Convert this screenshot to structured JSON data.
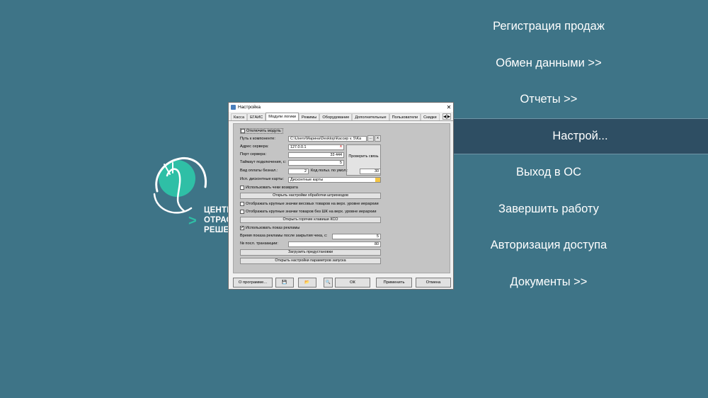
{
  "logo": {
    "line1": "ЦЕНТР",
    "line2": "ОТРАСЛЕ",
    "line3": "РЕШЕНИЙ",
    "arrow": ">",
    "accent": "#2fbfa6"
  },
  "menu": {
    "items": [
      {
        "label": "Регистрация продаж",
        "active": false
      },
      {
        "label": "Обмен данными >>",
        "active": false
      },
      {
        "label": "Отчеты >>",
        "active": false
      },
      {
        "label": "Настрой...",
        "active": true
      },
      {
        "label": "Выход в ОС",
        "active": false
      },
      {
        "label": "Завершить работу",
        "active": false
      },
      {
        "label": "Авторизация доступа",
        "active": false
      },
      {
        "label": "Документы >>",
        "active": false
      }
    ]
  },
  "dialog": {
    "title": "Настройка",
    "close": "✕",
    "tabs": [
      "Касса",
      "ЕГАИС",
      "Модули логики",
      "Режимы",
      "Оборудование",
      "Дополнительные",
      "Пользователи",
      "Скидки"
    ],
    "active_tab": "Модули логики",
    "tab_prev": "◀",
    "tab_next": "▶",
    "disable_module": "Отключить модуль",
    "component_path_label": "Путь к компоненте:",
    "component_path_value": "C:\\Users\\Марина\\Desktop\\Кассир v. 5\\Ka",
    "browse": "...",
    "clear": "x",
    "server_address_label": "Адрес сервера:",
    "server_address_value": "127.0.0.1",
    "server_port_label": "Порт сервера:",
    "server_port_value": "33 444",
    "check_connection": "Проверить связь",
    "timeout_label": "Таймаут подключения, с:",
    "timeout_value": "5",
    "cashless_label": "Вид оплаты безнал.:",
    "cashless_value": "2",
    "default_user_label": "Код польз. по умол.:",
    "default_user_value": "30",
    "discount_cards_label": "Исп. дисконтные карты:",
    "discount_cards_value": "Дисконтные карты",
    "use_return_checks": "Использовать чеки возврата",
    "open_barcode_settings": "Открыть настройки обработки штрихкодов",
    "show_large_weight_icons": "Отображать крупные значки весовых товаров на верх. уровне иерархии",
    "show_large_no_barcode_icons": "Отображать крупные значки товаров без ШК на верх. уровне иерархии",
    "open_hotkeys": "Открыть горячие клавиши КСО",
    "use_ads": "Использовать показ рекламы",
    "ad_time_label": "Время показа рекламы после закрытия чека, с:",
    "ad_time_value": "5",
    "last_tx_label": "№ посл. транзакции:",
    "last_tx_value": "80",
    "load_presets": "Загрузить предустановки",
    "open_launch_settings": "Открыть настройки параметров запуска",
    "about": "О программе...",
    "save_icon": "💾",
    "folder_icon": "📂",
    "search_icon": "🔍",
    "ok": "ОК",
    "apply": "Применить",
    "cancel": "Отмена"
  }
}
